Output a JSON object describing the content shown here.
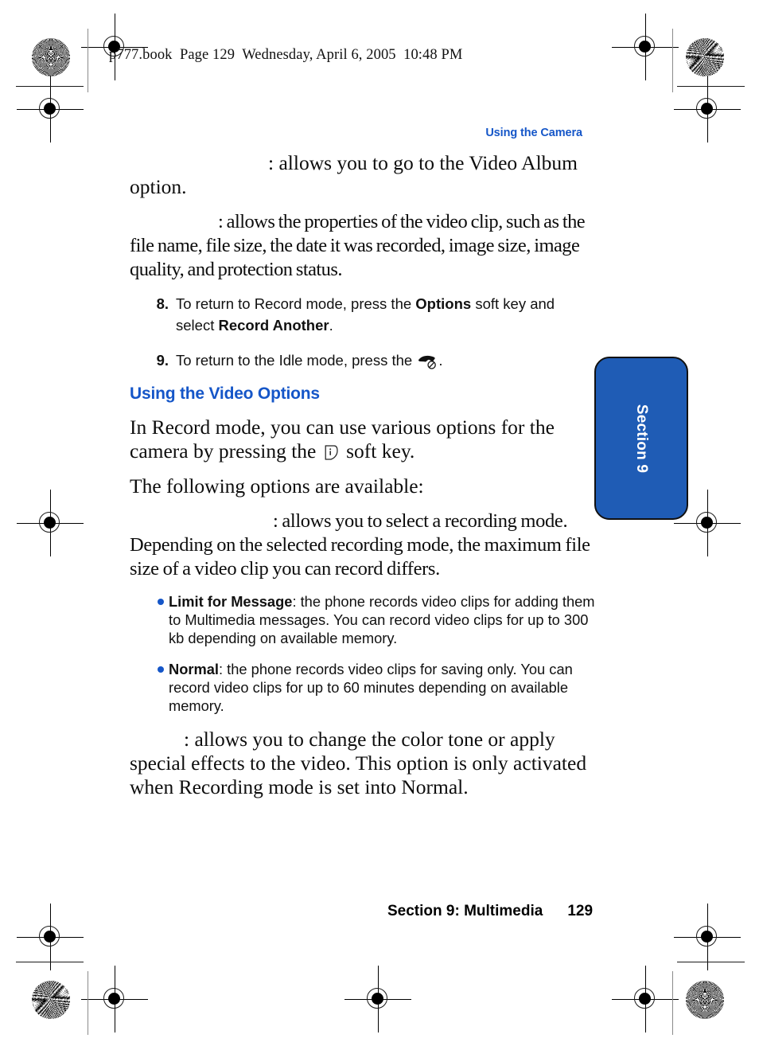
{
  "page": {
    "book_header": "p777.book  Page 129  Wednesday, April 6, 2005  10:48 PM",
    "running_head": "Using the Camera",
    "footer_section": "Section 9: Multimedia",
    "footer_page_number": "129",
    "thumb_tab_label": "Section 9",
    "accent_color": "#1556c8",
    "tab_fill_color": "#1f5cb5"
  },
  "body": {
    "para_video_album": ": allows you to go to the Video Album option.",
    "para_properties": ": allows the properties of the video clip, such as the file name, file size, the date it was recorded, image size, image quality, and protection status.",
    "para_recording_mode": ": allows you to select a recording mode. Depending on the selected recording mode, the maximum file size of a video clip you can record differs.",
    "para_effects": ": allows you to change the color tone or apply special effects to the video. This option is only activated when Recording mode is set into Normal."
  },
  "steps": [
    {
      "number": "8.",
      "text_before": "To return to Record mode, press the ",
      "bold_1": "Options",
      "text_middle": " soft key and select ",
      "bold_2": "Record Another",
      "text_after": "."
    },
    {
      "number": "9.",
      "text_before": "To return to the Idle mode, press the ",
      "icon": "end-call-icon",
      "text_after": "."
    }
  ],
  "subsection": {
    "heading": "Using the Video Options",
    "intro_before": "In Record mode, you can use various options for the camera by pressing the ",
    "intro_icon": "soft-key-icon",
    "intro_after": " soft key.",
    "available_line": "The following options are available:"
  },
  "bullets": [
    {
      "term": "Limit for Message",
      "description": ": the phone records video clips for adding them to Multimedia messages. You can record video clips for up to 300 kb depending on available memory."
    },
    {
      "term": "Normal",
      "description": ": the phone records video clips for saving only. You can record video clips for up to 60 minutes depending on available memory."
    }
  ]
}
